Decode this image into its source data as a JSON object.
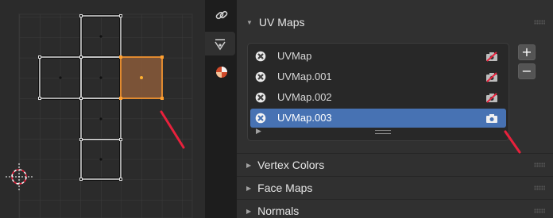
{
  "properties_tabs": [
    {
      "icon": "link-icon",
      "active": false
    },
    {
      "icon": "vertex-data-icon",
      "active": true
    },
    {
      "icon": "material-icon",
      "active": false
    }
  ],
  "uv_maps_panel": {
    "title": "UV Maps",
    "items": [
      {
        "label": "UVMap",
        "selected": false,
        "active_render": false
      },
      {
        "label": "UVMap.001",
        "selected": false,
        "active_render": false
      },
      {
        "label": "UVMap.002",
        "selected": false,
        "active_render": false
      },
      {
        "label": "UVMap.003",
        "selected": true,
        "active_render": true
      }
    ],
    "add_button": "+",
    "remove_button": "−"
  },
  "collapsed_sections": [
    {
      "title": "Vertex Colors"
    },
    {
      "title": "Face Maps"
    },
    {
      "title": "Normals"
    }
  ],
  "colors": {
    "selection_blue": "#4772b3",
    "selected_face_orange": "#e08a30",
    "annotation_red": "#e8213c"
  }
}
